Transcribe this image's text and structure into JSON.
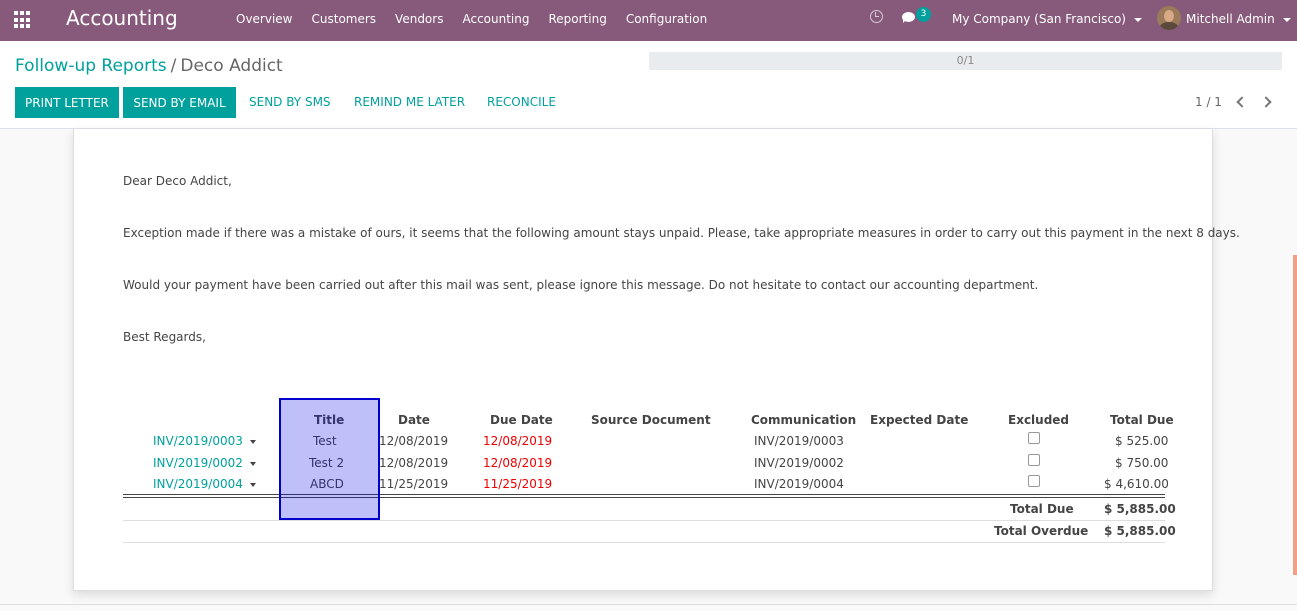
{
  "app": {
    "name": "Accounting"
  },
  "nav": {
    "menu": [
      "Overview",
      "Customers",
      "Vendors",
      "Accounting",
      "Reporting",
      "Configuration"
    ],
    "chat_count": "3",
    "company": "My Company (San Francisco)",
    "user": "Mitchell Admin"
  },
  "breadcrumb": {
    "parent": "Follow-up Reports",
    "separator": "/",
    "current": "Deco Addict"
  },
  "progress": {
    "label": "0/1",
    "fraction": 0
  },
  "actions": {
    "print_letter": "PRINT LETTER",
    "send_email": "SEND BY EMAIL",
    "send_sms": "SEND BY SMS",
    "remind_later": "REMIND ME LATER",
    "reconcile": "RECONCILE"
  },
  "pager": {
    "value": "1 / 1"
  },
  "letter": {
    "greeting": "Dear Deco Addict,",
    "body1": "Exception made if there was a mistake of ours, it seems that the following amount stays unpaid. Please, take appropriate measures in order to carry out this payment in the next 8 days.",
    "body2": "Would your payment have been carried out after this mail was sent, please ignore this message. Do not hesitate to contact our accounting department.",
    "closing": "Best Regards,"
  },
  "table": {
    "headers": [
      "Title",
      "Date",
      "Due Date",
      "Source Document",
      "Communication",
      "Expected Date",
      "Excluded",
      "Total Due"
    ],
    "rows": [
      {
        "invoice": "INV/2019/0003",
        "title": "Test",
        "date": "12/08/2019",
        "due_date": "12/08/2019",
        "source": "",
        "communication": "INV/2019/0003",
        "expected": "",
        "excluded": false,
        "total": "$ 525.00"
      },
      {
        "invoice": "INV/2019/0002",
        "title": "Test 2",
        "date": "12/08/2019",
        "due_date": "12/08/2019",
        "source": "",
        "communication": "INV/2019/0002",
        "expected": "",
        "excluded": false,
        "total": "$ 750.00"
      },
      {
        "invoice": "INV/2019/0004",
        "title": "ABCD",
        "date": "11/25/2019",
        "due_date": "11/25/2019",
        "source": "",
        "communication": "INV/2019/0004",
        "expected": "",
        "excluded": false,
        "total": "$ 4,610.00"
      }
    ],
    "totals": {
      "total_due_label": "Total Due",
      "total_due": "$ 5,885.00",
      "total_overdue_label": "Total Overdue",
      "total_overdue": "$ 5,885.00"
    }
  },
  "colors": {
    "navbar": "#875a7b",
    "accent": "#00a09d",
    "overdue": "#ee0000",
    "highlight": "#0000cc"
  }
}
